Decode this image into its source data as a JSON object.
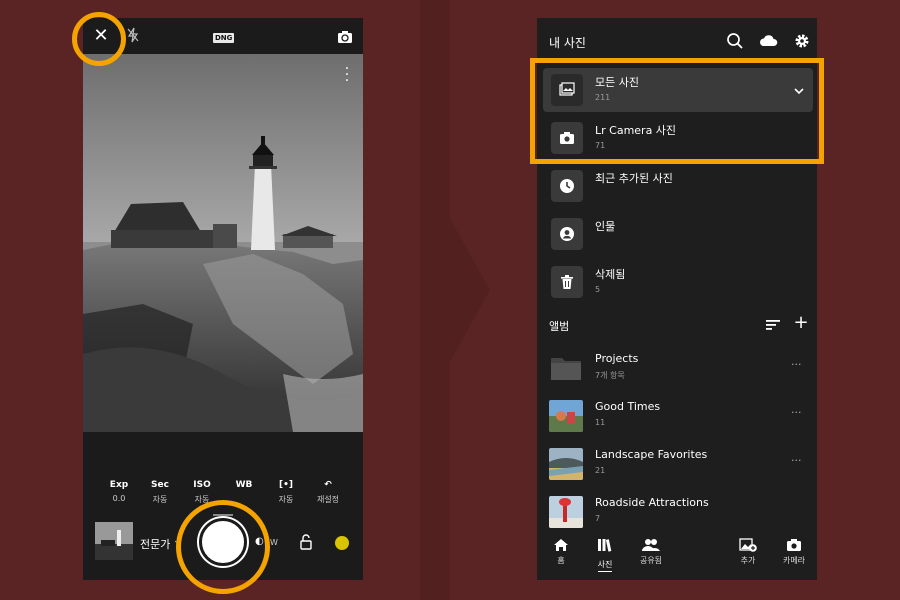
{
  "camera": {
    "top_bar": {
      "format_badge": "DNG"
    },
    "controls": [
      {
        "label": "Exp",
        "value": "0.0"
      },
      {
        "label": "Sec",
        "value": "자동"
      },
      {
        "label": "ISO",
        "value": "자동"
      },
      {
        "label": "WB",
        "value": ""
      },
      {
        "label": "[•]",
        "value": "자동"
      },
      {
        "label": "↶",
        "value": "재설정"
      }
    ],
    "mode_label": "전문가",
    "lens_label": "W"
  },
  "library": {
    "title": "내 사진",
    "rows": [
      {
        "title": "모든 사진",
        "sub": "211",
        "icon": "photos-icon"
      },
      {
        "title": "Lr Camera 사진",
        "sub": "71",
        "icon": "camera-icon"
      },
      {
        "title": "최근 추가된 사진",
        "sub": "",
        "icon": "clock-icon"
      },
      {
        "title": "인물",
        "sub": "",
        "icon": "person-icon"
      },
      {
        "title": "삭제됨",
        "sub": "5",
        "icon": "trash-icon"
      }
    ],
    "albums_header": "앨범",
    "albums": [
      {
        "title": "Projects",
        "sub": "7개 항목"
      },
      {
        "title": "Good Times",
        "sub": "11"
      },
      {
        "title": "Landscape Favorites",
        "sub": "21"
      },
      {
        "title": "Roadside Attractions",
        "sub": "7"
      }
    ],
    "more_glyph": "···",
    "tabs": [
      {
        "label": "홈",
        "icon": "home-icon"
      },
      {
        "label": "사진",
        "icon": "library-icon"
      },
      {
        "label": "공유됨",
        "icon": "people-icon"
      },
      {
        "label": "추가",
        "icon": "add-photo-icon"
      },
      {
        "label": "카메라",
        "icon": "camera-icon"
      }
    ]
  },
  "colors": {
    "background": "#5b2424",
    "highlight": "#f5a300",
    "panel": "#1e1e1e"
  }
}
